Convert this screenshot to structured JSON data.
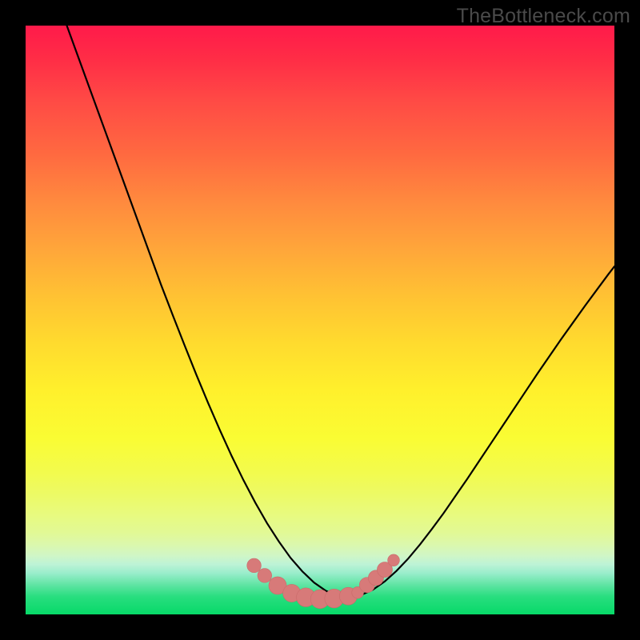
{
  "watermark": "TheBottleneck.com",
  "colors": {
    "frame": "#000000",
    "gradient_top": "#ff1a4a",
    "gradient_mid": "#fff02c",
    "gradient_bottom": "#07d968",
    "curve_stroke": "#000000",
    "marker_fill": "#d77a79",
    "marker_stroke": "#c96b6a"
  },
  "chart_data": {
    "type": "line",
    "title": "",
    "xlabel": "",
    "ylabel": "",
    "xlim": [
      0,
      100
    ],
    "ylim": [
      0,
      100
    ],
    "series": [
      {
        "name": "bottleneck-curve",
        "x": [
          7,
          9,
          11,
          13,
          15,
          17,
          19,
          21,
          23,
          25,
          27,
          29,
          31,
          33,
          35,
          37,
          39,
          41,
          43,
          45,
          47,
          49,
          51,
          53,
          55,
          57,
          59,
          61,
          63,
          65,
          67,
          69,
          71,
          73,
          75,
          77,
          79,
          81,
          83,
          85,
          87,
          89,
          91,
          93,
          95,
          97,
          99,
          100
        ],
        "y": [
          100,
          94.5,
          89,
          83.5,
          78,
          72.5,
          67,
          61.5,
          56,
          50.8,
          45.7,
          40.7,
          35.9,
          31.3,
          26.9,
          22.8,
          19.0,
          15.5,
          12.4,
          9.6,
          7.3,
          5.4,
          4.0,
          3.1,
          2.9,
          3.3,
          4.2,
          5.6,
          7.4,
          9.5,
          11.9,
          14.5,
          17.2,
          20.1,
          23.0,
          26.0,
          29.0,
          32.0,
          35.0,
          38.0,
          41.0,
          43.9,
          46.8,
          49.6,
          52.4,
          55.1,
          57.8,
          59.1
        ]
      }
    ],
    "markers": [
      {
        "x": 38.8,
        "y": 8.3,
        "r": 1.2
      },
      {
        "x": 40.6,
        "y": 6.6,
        "r": 1.2
      },
      {
        "x": 42.8,
        "y": 4.9,
        "r": 1.5
      },
      {
        "x": 45.2,
        "y": 3.6,
        "r": 1.5
      },
      {
        "x": 47.6,
        "y": 2.9,
        "r": 1.6
      },
      {
        "x": 50.0,
        "y": 2.6,
        "r": 1.6
      },
      {
        "x": 52.4,
        "y": 2.7,
        "r": 1.6
      },
      {
        "x": 54.8,
        "y": 3.1,
        "r": 1.5
      },
      {
        "x": 56.4,
        "y": 3.7,
        "r": 1.0
      },
      {
        "x": 58.0,
        "y": 5.0,
        "r": 1.3
      },
      {
        "x": 59.5,
        "y": 6.2,
        "r": 1.3
      },
      {
        "x": 61.0,
        "y": 7.6,
        "r": 1.3
      },
      {
        "x": 62.5,
        "y": 9.2,
        "r": 1.0
      }
    ]
  }
}
